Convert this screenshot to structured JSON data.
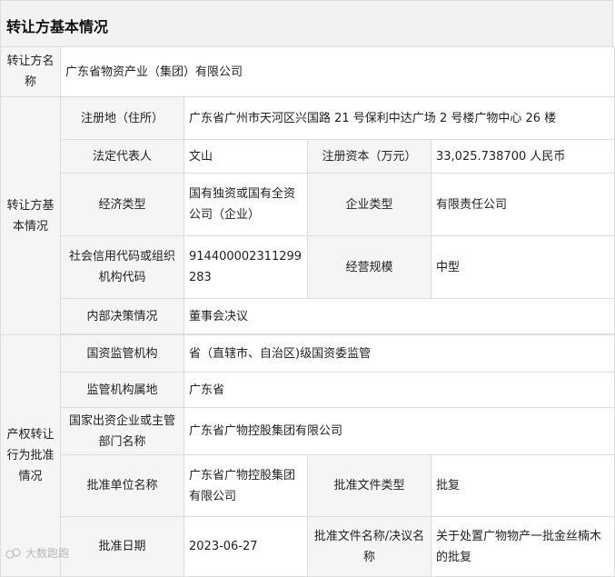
{
  "header": {
    "title": "转让方基本情况"
  },
  "transferor": {
    "label": "转让方名称",
    "value": "广东省物资产业（集团）有限公司"
  },
  "basic": {
    "group_label": "转让方基本情况",
    "reg_addr_label": "注册地（住所）",
    "reg_addr_value": "广东省广州市天河区兴国路 21 号保利中达广场 2 号楼广物中心 26 楼",
    "legal_rep_label": "法定代表人",
    "legal_rep_value": "文山",
    "capital_label": "注册资本（万元）",
    "capital_value": "33,025.738700 人民币",
    "econ_type_label": "经济类型",
    "econ_type_value": "国有独资或国有全资公司（企业）",
    "ent_type_label": "企业类型",
    "ent_type_value": "有限责任公司",
    "credit_code_label": "社会信用代码或组织机构代码",
    "credit_code_value": "914400002311299283",
    "scale_label": "经营规模",
    "scale_value": "中型",
    "decision_label": "内部决策情况",
    "decision_value": "董事会决议"
  },
  "approval": {
    "group_label": "产权转让行为批准情况",
    "regulator_label": "国资监管机构",
    "regulator_value": "省（直辖市、自治区)级国资委监管",
    "location_label": "监管机构属地",
    "location_value": "广东省",
    "investor_label": "国家出资企业或主管部门名称",
    "investor_value": "广东省广物控股集团有限公司",
    "approver_label": "批准单位名称",
    "approver_value": "广东省广物控股集团有限公司",
    "doc_type_label": "批准文件类型",
    "doc_type_value": "批复",
    "date_label": "批准日期",
    "date_value": "2023-06-27",
    "doc_name_label": "批准文件名称/决议名称",
    "doc_name_value": "关于处置广物物产一批金丝楠木的批复"
  },
  "watermark": {
    "text": "大数跑跑"
  }
}
